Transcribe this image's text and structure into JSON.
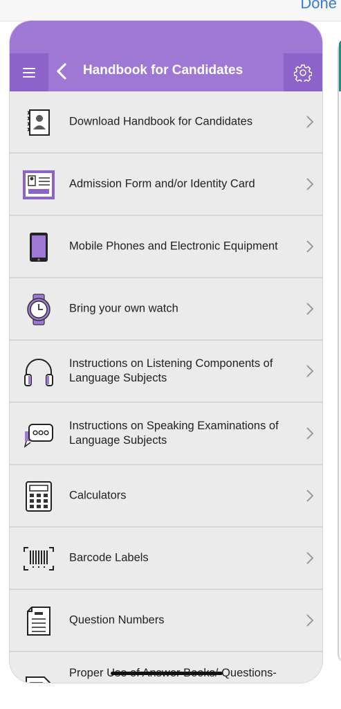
{
  "topbar": {
    "done_label": "Done"
  },
  "header": {
    "title": "Handbook for Candidates"
  },
  "colors": {
    "accent": "#9f78d6",
    "accent_dark": "#8d63c9",
    "row_bg": "#ebebeb"
  },
  "items": [
    {
      "label": "Download Handbook for Candidates",
      "icon": "handbook-icon"
    },
    {
      "label": "Admission Form and/or Identity Card",
      "icon": "id-card-icon"
    },
    {
      "label": "Mobile Phones and Electronic Equipment",
      "icon": "mobile-phone-icon"
    },
    {
      "label": "Bring your own watch",
      "icon": "watch-icon"
    },
    {
      "label": "Instructions on Listening Components of Language Subjects",
      "icon": "headphones-icon"
    },
    {
      "label": "Instructions on Speaking Examinations of Language Subjects",
      "icon": "speech-bubble-icon"
    },
    {
      "label": "Calculators",
      "icon": "calculator-icon"
    },
    {
      "label": "Barcode Labels",
      "icon": "barcode-icon"
    },
    {
      "label": "Question Numbers",
      "icon": "document-icon"
    },
    {
      "label": "Proper Use of Answer Books/ Questions-",
      "icon": "answer-book-icon"
    }
  ]
}
